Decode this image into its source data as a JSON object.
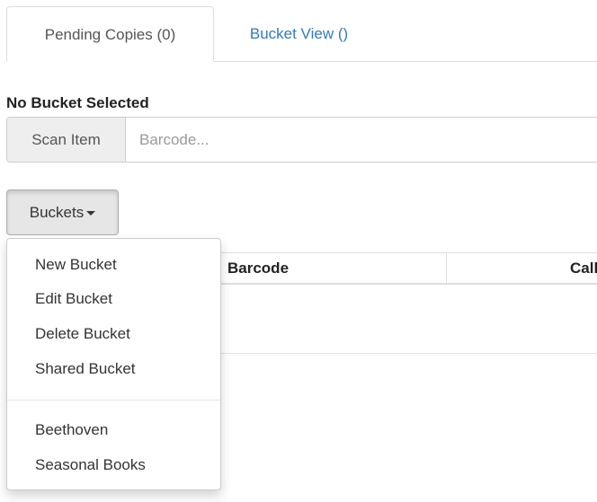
{
  "tabs": [
    {
      "label": "Pending Copies (0)"
    },
    {
      "label": "Bucket View ()"
    }
  ],
  "bucket": {
    "title": "No Bucket Selected"
  },
  "scan": {
    "addon_label": "Scan Item",
    "placeholder": "Barcode..."
  },
  "buckets_button": {
    "label": "Buckets"
  },
  "table": {
    "columns": [
      "Barcode",
      "Call"
    ]
  },
  "menu": {
    "actions": [
      "New Bucket",
      "Edit Bucket",
      "Delete Bucket",
      "Shared Bucket"
    ],
    "buckets": [
      "Beethoven",
      "Seasonal Books"
    ]
  },
  "colors": {
    "link": "#337ab7",
    "text": "#333333",
    "border": "#dddddd"
  }
}
